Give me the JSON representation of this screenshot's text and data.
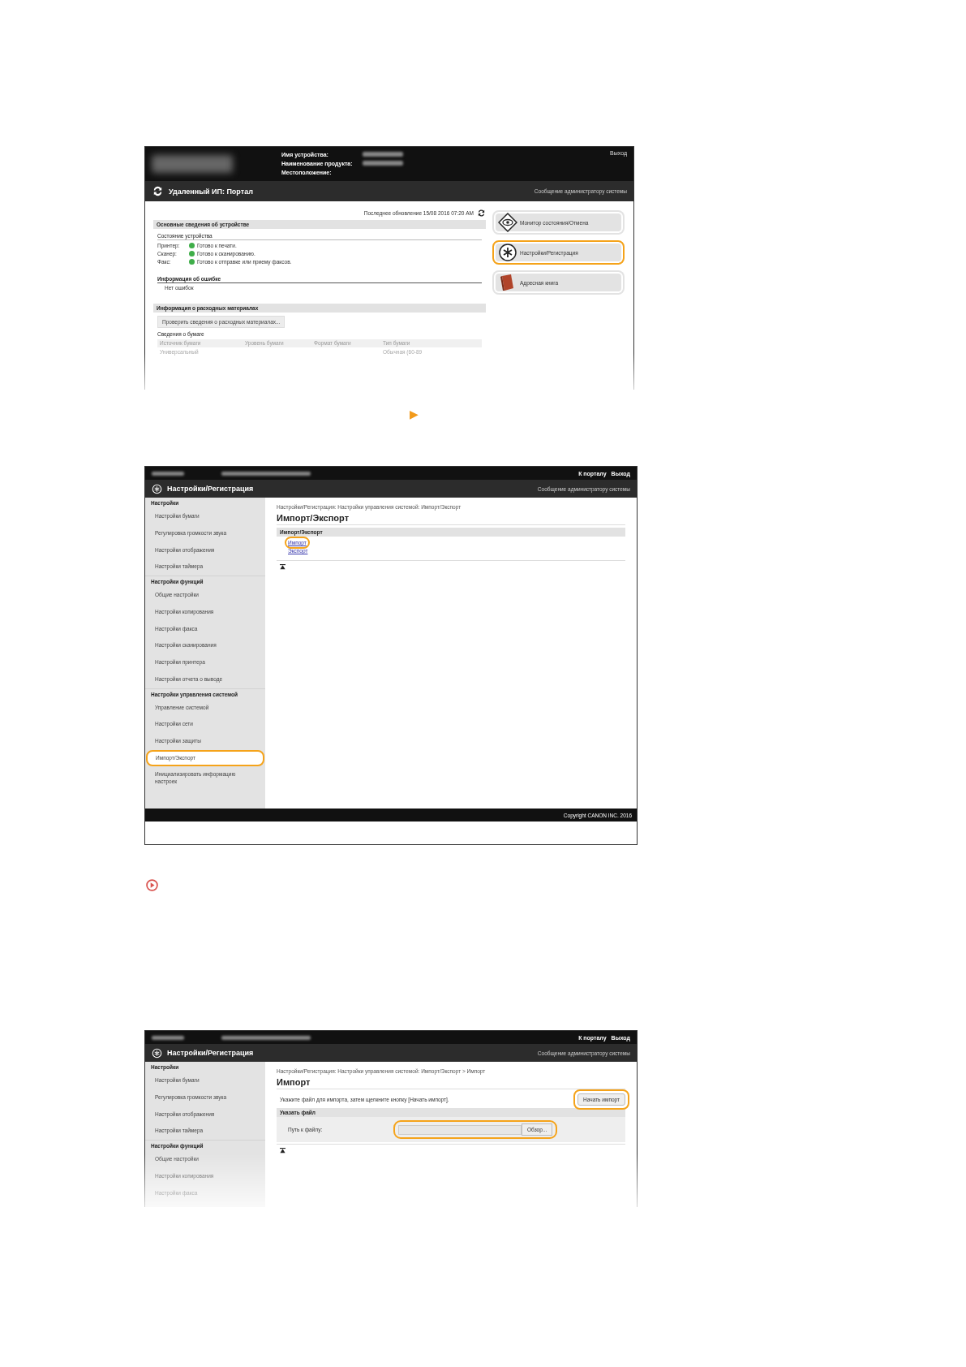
{
  "portal_screen": {
    "header": {
      "labels": [
        "Имя устройства:",
        "Наименование продукта:",
        "Местоположение:"
      ],
      "logout": "Выход"
    },
    "title": "Удаленный ИП: Портал",
    "admin_message": "Сообщение администратору системы",
    "last_update": "Последнее обновление 15/08 2016 07:20 AM",
    "device_info": {
      "heading": "Основные сведения об устройстве",
      "status_heading": "Состояние устройства",
      "statuses": [
        {
          "label": "Принтер:",
          "text": "Готово к печати."
        },
        {
          "label": "Сканер:",
          "text": "Готово к сканированию."
        },
        {
          "label": "Факс:",
          "text": "Готово к отправке или приему факсов."
        }
      ]
    },
    "error_info": {
      "heading": "Информация об ошибке",
      "text": "Нет ошибок"
    },
    "consumables": {
      "heading": "Информация о расходных материалах",
      "button": "Проверить сведения о расходных материалах...",
      "paper_heading": "Сведения о бумаге",
      "columns": [
        "Источник бумаги",
        "Уровень бумаги",
        "Формат бумаги",
        "Тип бумаги"
      ],
      "row": {
        "source": "Универсальный",
        "type": "Обычная (60-89"
      }
    },
    "menu": [
      {
        "label": "Монитор состояния/Отмена",
        "kind": "eye",
        "highlighted": false
      },
      {
        "label": "Настройки/Регистрация",
        "kind": "settings",
        "highlighted": true
      },
      {
        "label": "Адресная книга",
        "kind": "book",
        "highlighted": false
      }
    ]
  },
  "step_arrow": "▶",
  "import_export_screen": {
    "top_links": [
      "К порталу",
      "Выход"
    ],
    "title": "Настройки/Регистрация",
    "admin_message": "Сообщение администратору системы",
    "sidebar": [
      {
        "heading": "Настройки",
        "items": [
          {
            "label": "Настройки бумаги",
            "highlighted": false
          },
          {
            "label": "Регулировка громкости звука",
            "highlighted": false
          },
          {
            "label": "Настройки отображения",
            "highlighted": false
          },
          {
            "label": "Настройки таймера",
            "highlighted": false
          }
        ]
      },
      {
        "heading": "Настройки функций",
        "items": [
          {
            "label": "Общие настройки",
            "highlighted": false
          },
          {
            "label": "Настройки копирования",
            "highlighted": false
          },
          {
            "label": "Настройки факса",
            "highlighted": false
          },
          {
            "label": "Настройки сканирования",
            "highlighted": false
          },
          {
            "label": "Настройки принтера",
            "highlighted": false
          },
          {
            "label": "Настройки отчета о выводе",
            "highlighted": false
          }
        ]
      },
      {
        "heading": "Настройки управления системой",
        "items": [
          {
            "label": "Управление системой",
            "highlighted": false
          },
          {
            "label": "Настройки сети",
            "highlighted": false
          },
          {
            "label": "Настройки защиты",
            "highlighted": false
          },
          {
            "label": "Импорт/Экспорт",
            "highlighted": true
          },
          {
            "label": "Инициализировать информацию настроек",
            "highlighted": false
          }
        ]
      }
    ],
    "breadcrumb": "Настройки/Регистрация: Настройки управления системой: Импорт/Экспорт",
    "page_title": "Импорт/Экспорт",
    "section": "Импорт/Экспорт",
    "links": [
      {
        "label": "Импорт",
        "highlighted": true
      },
      {
        "label": "Экспорт",
        "highlighted": false
      }
    ],
    "footer": "Copyright CANON INC. 2016"
  },
  "import_screen": {
    "top_links": [
      "К порталу",
      "Выход"
    ],
    "title": "Настройки/Регистрация",
    "admin_message": "Сообщение администратору системы",
    "sidebar": [
      {
        "heading": "Настройки",
        "items": [
          {
            "label": "Настройки бумаги",
            "highlighted": false
          },
          {
            "label": "Регулировка громкости звука",
            "highlighted": false
          },
          {
            "label": "Настройки отображения",
            "highlighted": false
          },
          {
            "label": "Настройки таймера",
            "highlighted": false
          }
        ]
      },
      {
        "heading": "Настройки функций",
        "items": [
          {
            "label": "Общие настройки",
            "highlighted": false
          },
          {
            "label": "Настройки копирования",
            "highlighted": false
          },
          {
            "label": "Настройки факса",
            "highlighted": false
          }
        ]
      }
    ],
    "breadcrumb": "Настройки/Регистрация: Настройки управления системой: Импорт/Экспорт > Импорт",
    "page_title": "Импорт",
    "instruction": "Укажите файл для импорта, затем щелкните кнопку [Начать импорт].",
    "start_button": {
      "label": "Начать импорт",
      "highlighted": true
    },
    "section": "Указать файл",
    "field_label": "Путь к файлу:",
    "browse": {
      "label": "Обзор...",
      "highlighted": true
    }
  }
}
